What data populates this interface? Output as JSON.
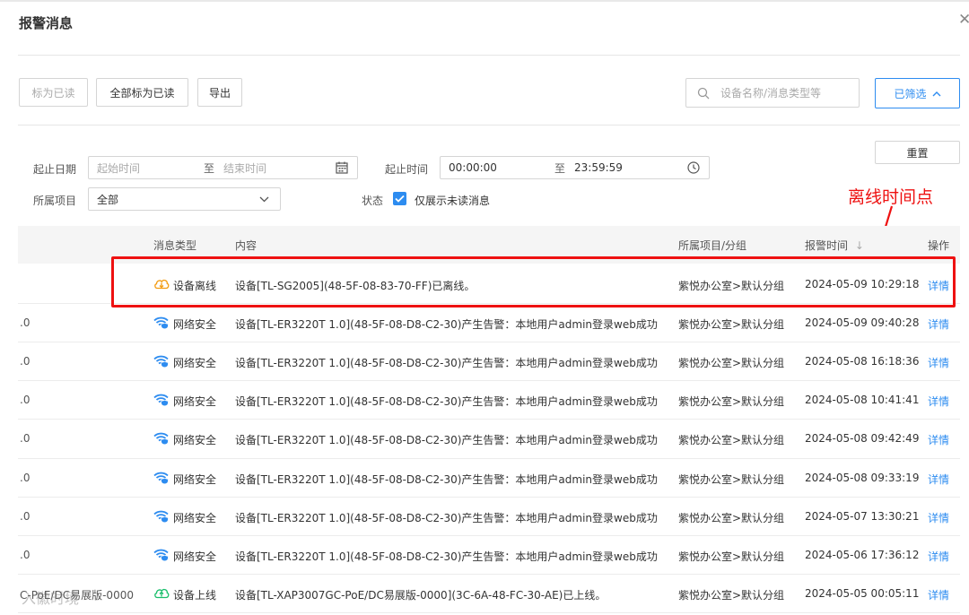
{
  "dialog": {
    "title": "报警消息"
  },
  "toolbar": {
    "mark_read": "标为已读",
    "mark_all_read": "全部标为已读",
    "export": "导出",
    "search_placeholder": "设备名称/消息类型等",
    "filtered": "已筛选"
  },
  "filters": {
    "reset": "重置",
    "date_label": "起止日期",
    "date_start_placeholder": "起始时间",
    "to": "至",
    "date_end_placeholder": "结束时间",
    "time_label": "起止时间",
    "time_start": "00:00:00",
    "time_end": "23:59:59",
    "project_label": "所属项目",
    "project_value": "全部",
    "status_label": "状态",
    "unread_only": "仅展示未读消息"
  },
  "annotation": "离线时间点",
  "table": {
    "headers": {
      "type": "消息类型",
      "content": "内容",
      "project": "所属项目/分组",
      "time": "报警时间",
      "action": "操作"
    },
    "rows": [
      {
        "left": "",
        "type": "设备离线",
        "icon": "cloud-offline-icon",
        "content": "设备[TL-SG2005](48-5F-08-83-70-FF)已离线。",
        "project": "紫悦办公室>默认分组",
        "time": "2024-05-09 10:29:18",
        "action": "详情"
      },
      {
        "left": ".0",
        "type": "网络安全",
        "icon": "wifi-shield-icon",
        "content": "设备[TL-ER3220T 1.0](48-5F-08-D8-C2-30)产生告警：本地用户admin登录web成功",
        "project": "紫悦办公室>默认分组",
        "time": "2024-05-09 09:40:28",
        "action": "详情"
      },
      {
        "left": ".0",
        "type": "网络安全",
        "icon": "wifi-shield-icon",
        "content": "设备[TL-ER3220T 1.0](48-5F-08-D8-C2-30)产生告警：本地用户admin登录web成功",
        "project": "紫悦办公室>默认分组",
        "time": "2024-05-08 16:18:36",
        "action": "详情"
      },
      {
        "left": ".0",
        "type": "网络安全",
        "icon": "wifi-shield-icon",
        "content": "设备[TL-ER3220T 1.0](48-5F-08-D8-C2-30)产生告警：本地用户admin登录web成功",
        "project": "紫悦办公室>默认分组",
        "time": "2024-05-08 10:41:41",
        "action": "详情"
      },
      {
        "left": ".0",
        "type": "网络安全",
        "icon": "wifi-shield-icon",
        "content": "设备[TL-ER3220T 1.0](48-5F-08-D8-C2-30)产生告警：本地用户admin登录web成功",
        "project": "紫悦办公室>默认分组",
        "time": "2024-05-08 09:42:49",
        "action": "详情"
      },
      {
        "left": ".0",
        "type": "网络安全",
        "icon": "wifi-shield-icon",
        "content": "设备[TL-ER3220T 1.0](48-5F-08-D8-C2-30)产生告警：本地用户admin登录web成功",
        "project": "紫悦办公室>默认分组",
        "time": "2024-05-08 09:33:19",
        "action": "详情"
      },
      {
        "left": ".0",
        "type": "网络安全",
        "icon": "wifi-shield-icon",
        "content": "设备[TL-ER3220T 1.0](48-5F-08-D8-C2-30)产生告警：本地用户admin登录web成功",
        "project": "紫悦办公室>默认分组",
        "time": "2024-05-07 13:30:21",
        "action": "详情"
      },
      {
        "left": ".0",
        "type": "网络安全",
        "icon": "wifi-shield-icon",
        "content": "设备[TL-ER3220T 1.0](48-5F-08-D8-C2-30)产生告警：本地用户admin登录web成功",
        "project": "紫悦办公室>默认分组",
        "time": "2024-05-06 17:36:12",
        "action": "详情"
      },
      {
        "left": "C-PoE/DC易展版-0000",
        "type": "设备上线",
        "icon": "cloud-online-icon",
        "content": "设备[TL-XAP3007GC-PoE/DC易展版-0000](3C-6A-48-FC-30-AE)已上线。",
        "project": "紫悦办公室>默认分组",
        "time": "2024-05-05 00:05:11",
        "action": "详情"
      }
    ]
  },
  "watermark": "入徽时境"
}
